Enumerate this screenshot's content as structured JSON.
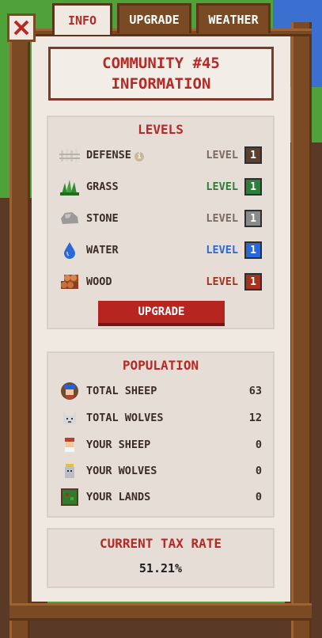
{
  "tabs": [
    {
      "label": "INFO",
      "active": true
    },
    {
      "label": "UPGRADE",
      "active": false
    },
    {
      "label": "WEATHER",
      "active": false
    }
  ],
  "title": {
    "line1": "COMMUNITY #45",
    "line2": "INFORMATION"
  },
  "levels": {
    "heading": "LEVELS",
    "items": [
      {
        "name": "DEFENSE",
        "level_word": "LEVEL",
        "level": "1",
        "color": "#5a4030",
        "icon": "fence-icon"
      },
      {
        "name": "GRASS",
        "level_word": "LEVEL",
        "level": "1",
        "color": "#2f7d3a",
        "icon": "grass-icon"
      },
      {
        "name": "STONE",
        "level_word": "LEVEL",
        "level": "1",
        "color": "#8a8a8a",
        "icon": "stone-icon"
      },
      {
        "name": "WATER",
        "level_word": "LEVEL",
        "level": "1",
        "color": "#2a68d8",
        "icon": "water-drop-icon"
      },
      {
        "name": "WOOD",
        "level_word": "LEVEL",
        "level": "1",
        "color": "#a3331f",
        "icon": "wood-logs-icon"
      }
    ],
    "upgrade_label": "UPGRADE"
  },
  "population": {
    "heading": "POPULATION",
    "items": [
      {
        "label": "TOTAL SHEEP",
        "value": "63",
        "icon": "shepherd-avatar-icon"
      },
      {
        "label": "TOTAL WOLVES",
        "value": "12",
        "icon": "wolf-avatar-icon"
      },
      {
        "label": "YOUR SHEEP",
        "value": "0",
        "icon": "sheep-small-icon"
      },
      {
        "label": "YOUR WOLVES",
        "value": "0",
        "icon": "wolf-small-icon"
      },
      {
        "label": "YOUR LANDS",
        "value": "0",
        "icon": "land-icon"
      }
    ]
  },
  "tax": {
    "heading": "CURRENT TAX RATE",
    "value": "51.21%"
  },
  "colors": {
    "accent": "#b52a26",
    "frame": "#7a4a24",
    "panel": "#efe9e2"
  }
}
